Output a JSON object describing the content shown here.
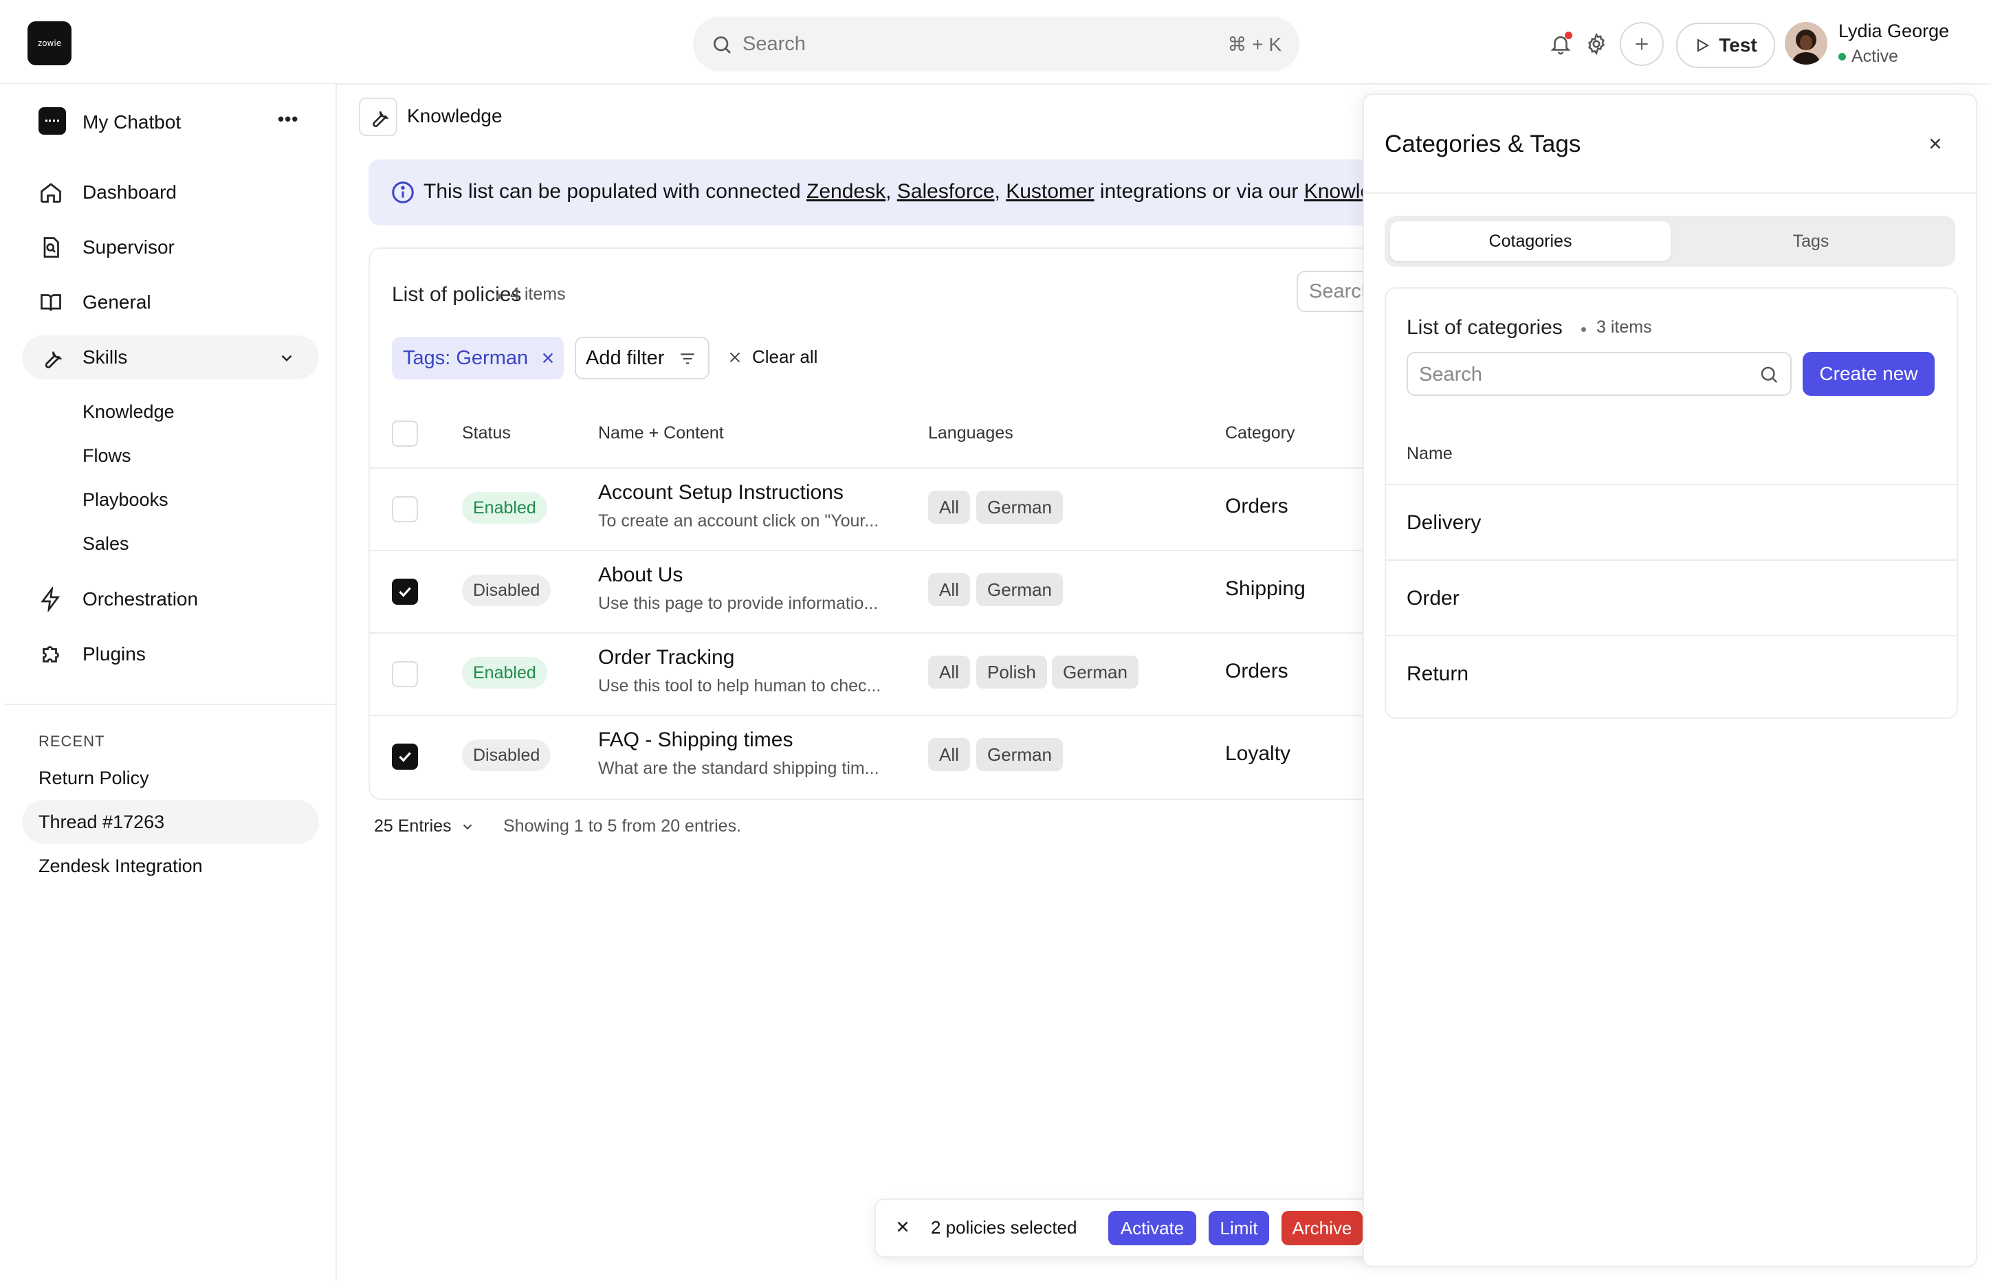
{
  "topbar": {
    "logo_text": "zowie",
    "search_placeholder": "Search",
    "search_shortcut": "⌘ + K",
    "test_label": "Test",
    "user_name": "Lydia George",
    "user_status": "Active"
  },
  "sidebar": {
    "bot_name": "My Chatbot",
    "more_label": "•••",
    "items": [
      {
        "label": "Dashboard",
        "icon": "home-icon"
      },
      {
        "label": "Supervisor",
        "icon": "supervisor-icon"
      },
      {
        "label": "General",
        "icon": "book-icon"
      },
      {
        "label": "Skills",
        "icon": "wrench-icon"
      },
      {
        "label": "Orchestration",
        "icon": "bolt-icon"
      },
      {
        "label": "Plugins",
        "icon": "puzzle-icon"
      }
    ],
    "skills_sub": [
      "Knowledge",
      "Flows",
      "Playbooks",
      "Sales"
    ],
    "recent_heading": "RECENT",
    "recent": [
      "Return Policy",
      "Thread #17263",
      "Zendesk Integration"
    ]
  },
  "main": {
    "breadcrumb": "Knowledge",
    "banner": {
      "prefix": "This list can be populated with connected ",
      "link1": "Zendesk",
      "sep1": ", ",
      "link2": "Salesforce",
      "sep2": ", ",
      "link3": "Kustomer",
      "middle": " integrations or via our ",
      "link4": "Knowle"
    },
    "list_title": "List of policies",
    "list_count": "4 items",
    "search_placeholder": "Search",
    "filter_chip": "Tags: German",
    "add_filter": "Add filter",
    "clear_all": "Clear all",
    "columns": [
      "Status",
      "Name + Content",
      "Languages",
      "Category"
    ],
    "rows": [
      {
        "checked": false,
        "status": "Enabled",
        "name": "Account Setup Instructions",
        "desc": "To create an account click on \"Your...",
        "langs": [
          "All",
          "German"
        ],
        "category": "Orders"
      },
      {
        "checked": true,
        "status": "Disabled",
        "name": "About Us",
        "desc": "Use this page to provide informatio...",
        "langs": [
          "All",
          "German"
        ],
        "category": "Shipping"
      },
      {
        "checked": false,
        "status": "Enabled",
        "name": "Order Tracking",
        "desc": "Use this tool to help human to chec...",
        "langs": [
          "All",
          "Polish",
          "German"
        ],
        "category": "Orders"
      },
      {
        "checked": true,
        "status": "Disabled",
        "name": "FAQ - Shipping times",
        "desc": "What are the standard shipping tim...",
        "langs": [
          "All",
          "German"
        ],
        "category": "Loyalty"
      }
    ],
    "entries_label": "25 Entries",
    "showing": "Showing 1 to 5 from 20 entries."
  },
  "bulk_bar": {
    "selected": "2 policies selected",
    "activate": "Activate",
    "limit": "Limit",
    "archive": "Archive"
  },
  "drawer": {
    "title": "Categories & Tags",
    "tab_active": "Cotagories",
    "tab_inactive": "Tags",
    "list_title": "List of categories",
    "list_count": "3 items",
    "search_placeholder": "Search",
    "create_label": "Create new",
    "column": "Name",
    "categories": [
      "Delivery",
      "Order",
      "Return"
    ]
  },
  "colors": {
    "accent": "#4f4fe6",
    "enabled_bg": "#e4f6ea",
    "enabled_text": "#1f8b4c",
    "archive": "#d63a33",
    "banner_bg": "#ecedfb",
    "notification_dot": "#e53935"
  }
}
